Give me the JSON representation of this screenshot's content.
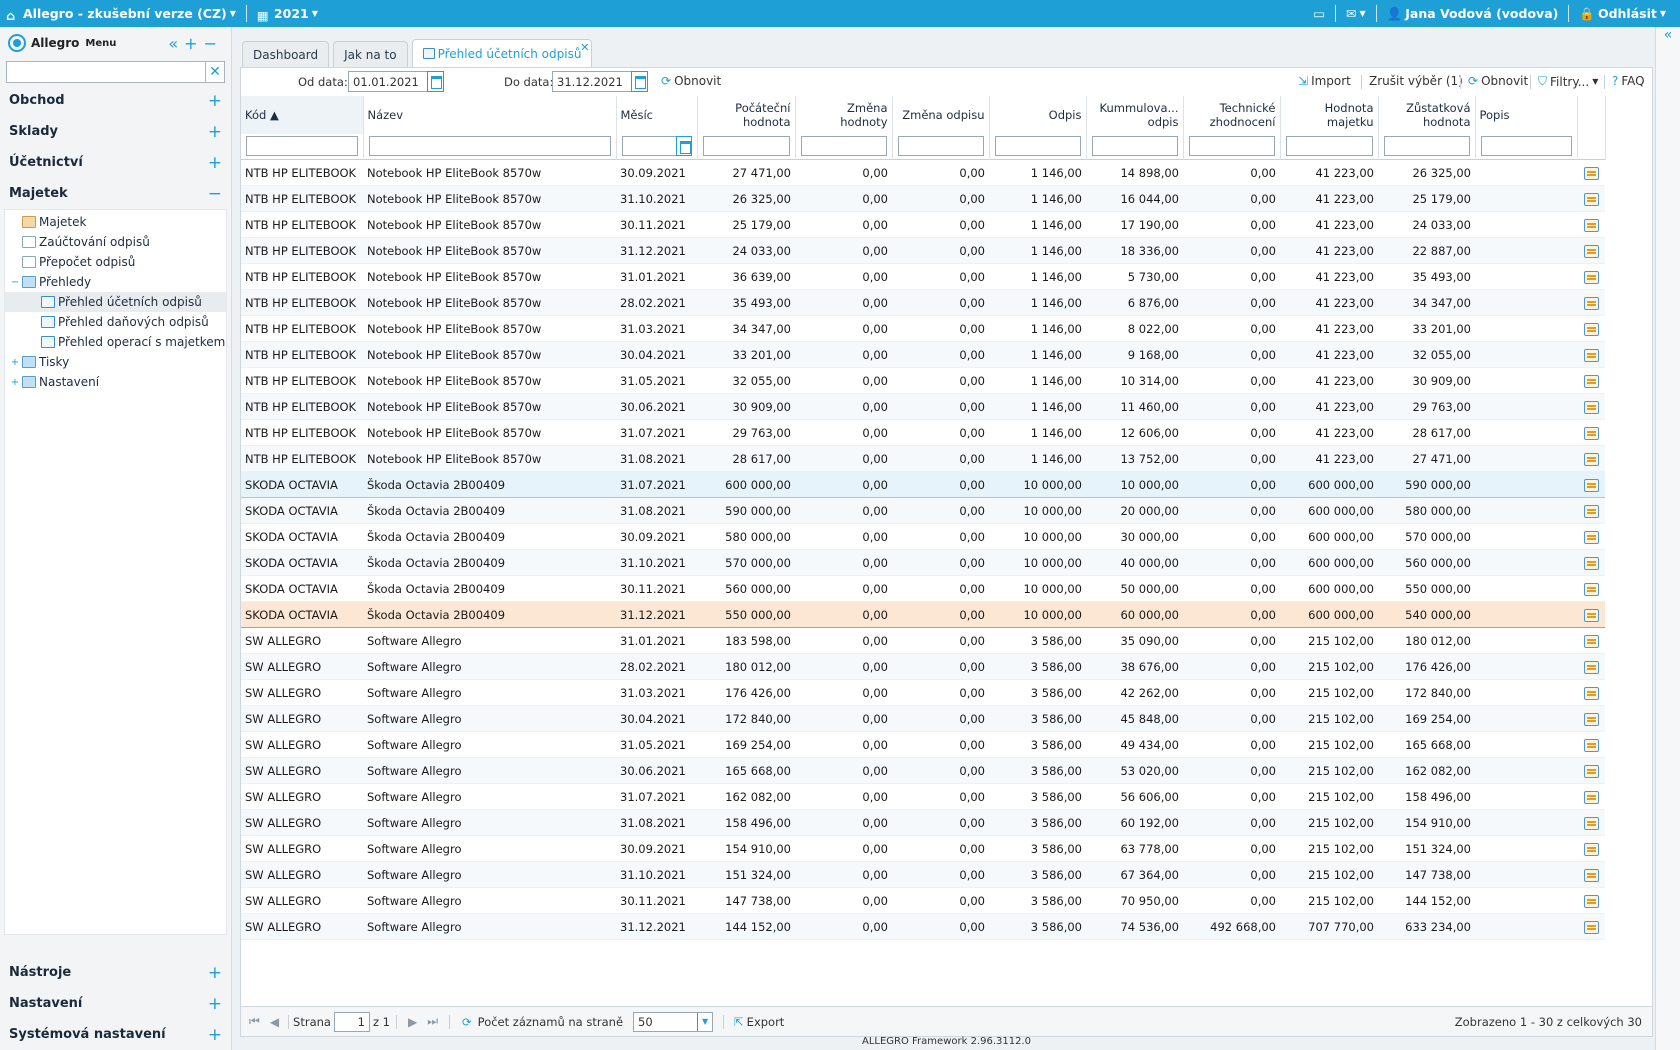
{
  "topbar": {
    "app_title": "Allegro - zkušební verze (CZ)",
    "year": "2021",
    "user": "Jana Vodová (vodova)",
    "logout": "Odhlásit"
  },
  "sidebar": {
    "brand": "Allegro",
    "menu_label": "Menu",
    "sections_top": [
      "Obchod",
      "Sklady",
      "Účetnictví"
    ],
    "majetek": "Majetek",
    "tree": [
      {
        "label": "Majetek",
        "icon": "asset-icon",
        "level": 1,
        "expand": ""
      },
      {
        "label": "Zaúčtování odpisů",
        "icon": "doc-icon",
        "level": 1,
        "expand": ""
      },
      {
        "label": "Přepočet odpisů",
        "icon": "calculator-icon",
        "level": 1,
        "expand": ""
      },
      {
        "label": "Přehledy",
        "icon": "folder-icon",
        "level": 1,
        "expand": "−"
      },
      {
        "label": "Přehled účetních odpisů",
        "icon": "report-icon",
        "level": 2,
        "expand": "",
        "selected": true
      },
      {
        "label": "Přehled daňových odpisů",
        "icon": "report-icon",
        "level": 2,
        "expand": ""
      },
      {
        "label": "Přehled operací s majetkem",
        "icon": "report-icon",
        "level": 2,
        "expand": ""
      },
      {
        "label": "Tisky",
        "icon": "folder-icon",
        "level": 1,
        "expand": "+"
      },
      {
        "label": "Nastavení",
        "icon": "folder-icon",
        "level": 1,
        "expand": "+"
      }
    ],
    "sections_bottom": [
      "Nástroje",
      "Nastavení",
      "Systémová nastavení"
    ]
  },
  "tabs": [
    "Dashboard",
    "Jak na to",
    "Přehled účetních odpisů"
  ],
  "toolbar": {
    "od_label": "Od data:",
    "od_value": "01.01.2021",
    "do_label": "Do data:",
    "do_value": "31.12.2021",
    "refresh": "Obnovit",
    "import": "Import",
    "clear_selection": "Zrušit výběr (1)",
    "refresh2": "Obnovit",
    "filters": "Filtry...",
    "faq": "FAQ"
  },
  "columns": [
    {
      "label": "Kód ▲",
      "align": "l"
    },
    {
      "label": "Název",
      "align": "l"
    },
    {
      "label": "Měsíc",
      "align": "l"
    },
    {
      "label": "Počáteční hodnota",
      "align": "r"
    },
    {
      "label": "Změna hodnoty",
      "align": "r"
    },
    {
      "label": "Změna odpisu",
      "align": "r"
    },
    {
      "label": "Odpis",
      "align": "r"
    },
    {
      "label": "Kummulova... odpis",
      "align": "r"
    },
    {
      "label": "Technické zhodnocení",
      "align": "r"
    },
    {
      "label": "Hodnota majetku",
      "align": "r"
    },
    {
      "label": "Zůstatková hodnota",
      "align": "r"
    },
    {
      "label": "Popis",
      "align": "l"
    },
    {
      "label": "",
      "align": "l"
    }
  ],
  "rows": [
    [
      "NTB HP ELITEBOOK",
      "Notebook HP EliteBook 8570w",
      "30.09.2021",
      "27 471,00",
      "0,00",
      "0,00",
      "1 146,00",
      "14 898,00",
      "0,00",
      "41 223,00",
      "26 325,00",
      ""
    ],
    [
      "NTB HP ELITEBOOK",
      "Notebook HP EliteBook 8570w",
      "31.10.2021",
      "26 325,00",
      "0,00",
      "0,00",
      "1 146,00",
      "16 044,00",
      "0,00",
      "41 223,00",
      "25 179,00",
      ""
    ],
    [
      "NTB HP ELITEBOOK",
      "Notebook HP EliteBook 8570w",
      "30.11.2021",
      "25 179,00",
      "0,00",
      "0,00",
      "1 146,00",
      "17 190,00",
      "0,00",
      "41 223,00",
      "24 033,00",
      ""
    ],
    [
      "NTB HP ELITEBOOK",
      "Notebook HP EliteBook 8570w",
      "31.12.2021",
      "24 033,00",
      "0,00",
      "0,00",
      "1 146,00",
      "18 336,00",
      "0,00",
      "41 223,00",
      "22 887,00",
      ""
    ],
    [
      "NTB HP ELITEBOOK",
      "Notebook HP EliteBook 8570w",
      "31.01.2021",
      "36 639,00",
      "0,00",
      "0,00",
      "1 146,00",
      "5 730,00",
      "0,00",
      "41 223,00",
      "35 493,00",
      ""
    ],
    [
      "NTB HP ELITEBOOK",
      "Notebook HP EliteBook 8570w",
      "28.02.2021",
      "35 493,00",
      "0,00",
      "0,00",
      "1 146,00",
      "6 876,00",
      "0,00",
      "41 223,00",
      "34 347,00",
      ""
    ],
    [
      "NTB HP ELITEBOOK",
      "Notebook HP EliteBook 8570w",
      "31.03.2021",
      "34 347,00",
      "0,00",
      "0,00",
      "1 146,00",
      "8 022,00",
      "0,00",
      "41 223,00",
      "33 201,00",
      ""
    ],
    [
      "NTB HP ELITEBOOK",
      "Notebook HP EliteBook 8570w",
      "30.04.2021",
      "33 201,00",
      "0,00",
      "0,00",
      "1 146,00",
      "9 168,00",
      "0,00",
      "41 223,00",
      "32 055,00",
      ""
    ],
    [
      "NTB HP ELITEBOOK",
      "Notebook HP EliteBook 8570w",
      "31.05.2021",
      "32 055,00",
      "0,00",
      "0,00",
      "1 146,00",
      "10 314,00",
      "0,00",
      "41 223,00",
      "30 909,00",
      ""
    ],
    [
      "NTB HP ELITEBOOK",
      "Notebook HP EliteBook 8570w",
      "30.06.2021",
      "30 909,00",
      "0,00",
      "0,00",
      "1 146,00",
      "11 460,00",
      "0,00",
      "41 223,00",
      "29 763,00",
      ""
    ],
    [
      "NTB HP ELITEBOOK",
      "Notebook HP EliteBook 8570w",
      "31.07.2021",
      "29 763,00",
      "0,00",
      "0,00",
      "1 146,00",
      "12 606,00",
      "0,00",
      "41 223,00",
      "28 617,00",
      ""
    ],
    [
      "NTB HP ELITEBOOK",
      "Notebook HP EliteBook 8570w",
      "31.08.2021",
      "28 617,00",
      "0,00",
      "0,00",
      "1 146,00",
      "13 752,00",
      "0,00",
      "41 223,00",
      "27 471,00",
      ""
    ],
    [
      "SKODA OCTAVIA",
      "Škoda Octavia 2B00409",
      "31.07.2021",
      "600 000,00",
      "0,00",
      "0,00",
      "10 000,00",
      "10 000,00",
      "0,00",
      "600 000,00",
      "590 000,00",
      ""
    ],
    [
      "SKODA OCTAVIA",
      "Škoda Octavia 2B00409",
      "31.08.2021",
      "590 000,00",
      "0,00",
      "0,00",
      "10 000,00",
      "20 000,00",
      "0,00",
      "600 000,00",
      "580 000,00",
      ""
    ],
    [
      "SKODA OCTAVIA",
      "Škoda Octavia 2B00409",
      "30.09.2021",
      "580 000,00",
      "0,00",
      "0,00",
      "10 000,00",
      "30 000,00",
      "0,00",
      "600 000,00",
      "570 000,00",
      ""
    ],
    [
      "SKODA OCTAVIA",
      "Škoda Octavia 2B00409",
      "31.10.2021",
      "570 000,00",
      "0,00",
      "0,00",
      "10 000,00",
      "40 000,00",
      "0,00",
      "600 000,00",
      "560 000,00",
      ""
    ],
    [
      "SKODA OCTAVIA",
      "Škoda Octavia 2B00409",
      "30.11.2021",
      "560 000,00",
      "0,00",
      "0,00",
      "10 000,00",
      "50 000,00",
      "0,00",
      "600 000,00",
      "550 000,00",
      ""
    ],
    [
      "SKODA OCTAVIA",
      "Škoda Octavia 2B00409",
      "31.12.2021",
      "550 000,00",
      "0,00",
      "0,00",
      "10 000,00",
      "60 000,00",
      "0,00",
      "600 000,00",
      "540 000,00",
      ""
    ],
    [
      "SW ALLEGRO",
      "Software Allegro",
      "31.01.2021",
      "183 598,00",
      "0,00",
      "0,00",
      "3 586,00",
      "35 090,00",
      "0,00",
      "215 102,00",
      "180 012,00",
      ""
    ],
    [
      "SW ALLEGRO",
      "Software Allegro",
      "28.02.2021",
      "180 012,00",
      "0,00",
      "0,00",
      "3 586,00",
      "38 676,00",
      "0,00",
      "215 102,00",
      "176 426,00",
      ""
    ],
    [
      "SW ALLEGRO",
      "Software Allegro",
      "31.03.2021",
      "176 426,00",
      "0,00",
      "0,00",
      "3 586,00",
      "42 262,00",
      "0,00",
      "215 102,00",
      "172 840,00",
      ""
    ],
    [
      "SW ALLEGRO",
      "Software Allegro",
      "30.04.2021",
      "172 840,00",
      "0,00",
      "0,00",
      "3 586,00",
      "45 848,00",
      "0,00",
      "215 102,00",
      "169 254,00",
      ""
    ],
    [
      "SW ALLEGRO",
      "Software Allegro",
      "31.05.2021",
      "169 254,00",
      "0,00",
      "0,00",
      "3 586,00",
      "49 434,00",
      "0,00",
      "215 102,00",
      "165 668,00",
      ""
    ],
    [
      "SW ALLEGRO",
      "Software Allegro",
      "30.06.2021",
      "165 668,00",
      "0,00",
      "0,00",
      "3 586,00",
      "53 020,00",
      "0,00",
      "215 102,00",
      "162 082,00",
      ""
    ],
    [
      "SW ALLEGRO",
      "Software Allegro",
      "31.07.2021",
      "162 082,00",
      "0,00",
      "0,00",
      "3 586,00",
      "56 606,00",
      "0,00",
      "215 102,00",
      "158 496,00",
      ""
    ],
    [
      "SW ALLEGRO",
      "Software Allegro",
      "31.08.2021",
      "158 496,00",
      "0,00",
      "0,00",
      "3 586,00",
      "60 192,00",
      "0,00",
      "215 102,00",
      "154 910,00",
      ""
    ],
    [
      "SW ALLEGRO",
      "Software Allegro",
      "30.09.2021",
      "154 910,00",
      "0,00",
      "0,00",
      "3 586,00",
      "63 778,00",
      "0,00",
      "215 102,00",
      "151 324,00",
      ""
    ],
    [
      "SW ALLEGRO",
      "Software Allegro",
      "31.10.2021",
      "151 324,00",
      "0,00",
      "0,00",
      "3 586,00",
      "67 364,00",
      "0,00",
      "215 102,00",
      "147 738,00",
      ""
    ],
    [
      "SW ALLEGRO",
      "Software Allegro",
      "30.11.2021",
      "147 738,00",
      "0,00",
      "0,00",
      "3 586,00",
      "70 950,00",
      "0,00",
      "215 102,00",
      "144 152,00",
      ""
    ],
    [
      "SW ALLEGRO",
      "Software Allegro",
      "31.12.2021",
      "144 152,00",
      "0,00",
      "0,00",
      "3 586,00",
      "74 536,00",
      "492 668,00",
      "707 770,00",
      "633 234,00",
      ""
    ]
  ],
  "highlight_row": 12,
  "selected_row": 17,
  "pager": {
    "strana": "Strana",
    "page": "1",
    "of": "z 1",
    "per_page_label": "Počet záznamů na straně",
    "per_page": "50",
    "export": "Export",
    "summary": "Zobrazeno 1 - 30 z celkových 30"
  },
  "footer": "ALLEGRO Framework 2.96.3112.0",
  "colors": {
    "accent": "#1e9fd6",
    "selected_row": "#fbe7d4"
  }
}
